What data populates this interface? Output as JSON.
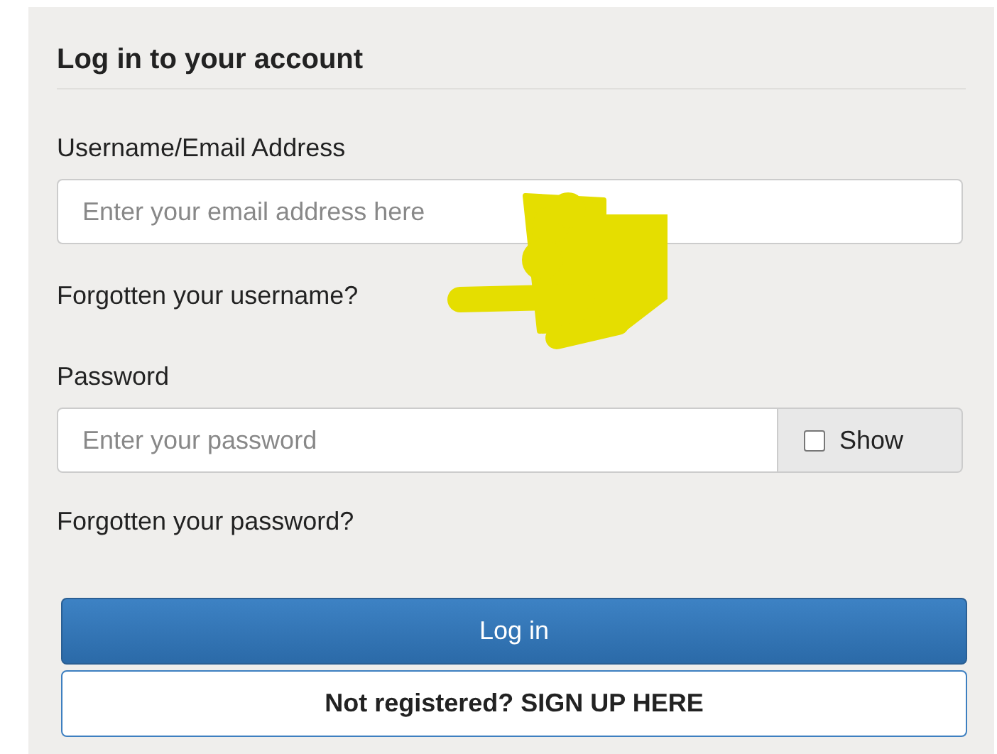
{
  "title": "Log in to your account",
  "username": {
    "label": "Username/Email Address",
    "placeholder": "Enter your email address here"
  },
  "forgot_username": "Forgotten your username?",
  "password": {
    "label": "Password",
    "placeholder": "Enter your password"
  },
  "show_password": {
    "label": "Show",
    "checked": false
  },
  "forgot_password": "Forgotten your password?",
  "buttons": [
    {
      "kind": "primary",
      "label": "Log in"
    },
    {
      "kind": "secondary",
      "label": "Not registered? SIGN UP HERE"
    }
  ]
}
